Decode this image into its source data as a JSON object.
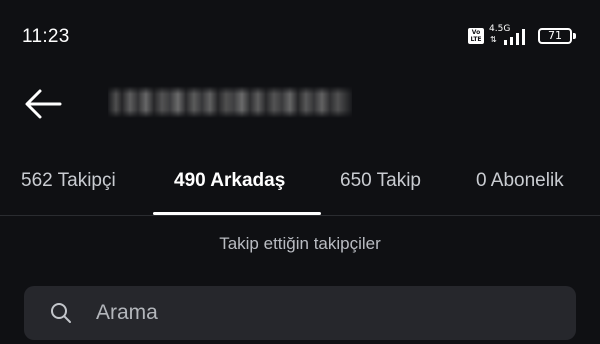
{
  "status_bar": {
    "time": "11:23",
    "volte_line1": "Vo",
    "volte_line2": "LTE",
    "network_type": "4.5G",
    "network_arrows": "⇅",
    "battery_level": "71"
  },
  "header": {
    "back_icon": "arrow-left-icon",
    "username": ""
  },
  "tabs": [
    {
      "label": "562 Takipçi",
      "active": false
    },
    {
      "label": "490 Arkadaş",
      "active": true
    },
    {
      "label": "650 Takip",
      "active": false
    },
    {
      "label": "0 Abonelik",
      "active": false
    }
  ],
  "section_note": "Takip ettiğin takipçiler",
  "search": {
    "placeholder": "Arama",
    "value": "",
    "icon": "search-icon"
  },
  "colors": {
    "background": "#0f1013",
    "search_bg": "#26272c",
    "active_indicator": "#ffffff"
  }
}
